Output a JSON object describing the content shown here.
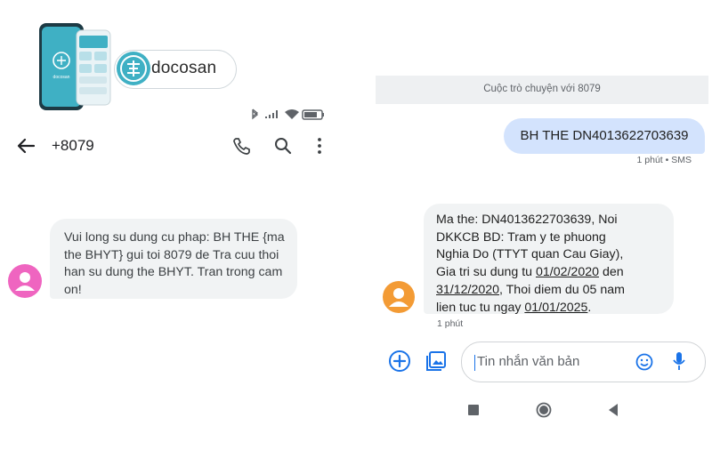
{
  "brand": {
    "name": "docosan",
    "phone_logo_text": "docosan"
  },
  "left": {
    "contact": "+8079",
    "message": "Vui long su dung cu phap: BH THE {ma the BHYT} gui toi 8079 de Tra cuu thoi han su dung the BHYT. Tran trong cam on!",
    "icons": [
      "back-arrow-icon",
      "phone-icon",
      "search-icon",
      "more-vert-icon",
      "bluetooth-icon",
      "signal-icon",
      "wifi-icon",
      "battery-icon"
    ]
  },
  "right": {
    "conversation_label": "Cuộc trò chuyện với 8079",
    "outgoing": {
      "text": "BH THE DN4013622703639",
      "meta": "1 phút • SMS"
    },
    "incoming": {
      "lines": [
        {
          "plain": "Ma the: DN4013622703639, Noi"
        },
        {
          "plain": "DKKCB BD: Tram y te phuong"
        },
        {
          "plain": "Nghia Do (TTYT quan Cau Giay),"
        },
        {
          "pre": "Gia tri su dung tu ",
          "u": "01/02/2020",
          "post": " den"
        },
        {
          "pre": "",
          "u": "31/12/2020",
          "post": ", Thoi diem du 05 nam"
        },
        {
          "pre": "lien tuc tu ngay ",
          "u": "01/01/2025",
          "post": "."
        }
      ],
      "meta": "1 phút"
    },
    "compose_placeholder": "Tin nhắn văn bản"
  },
  "colors": {
    "outgoing_bubble": "#d3e3fd",
    "incoming_bubble": "#f1f3f4",
    "avatar_left": "#ef65c0",
    "avatar_right": "#f39b35",
    "accent_blue": "#1a73e8",
    "brand_teal": "#3fb0c4"
  }
}
